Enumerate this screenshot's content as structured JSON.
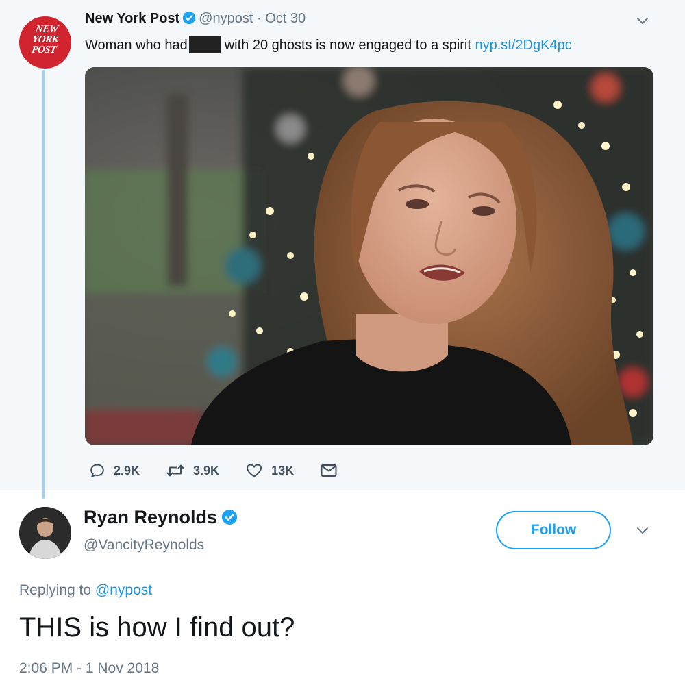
{
  "original_tweet": {
    "author_name": "New York Post",
    "author_handle": "@nypost",
    "separator": "·",
    "date": "Oct 30",
    "avatar_text": [
      "NEW",
      "YORK",
      "POST"
    ],
    "text_before": "Woman who had",
    "text_after": "with 20 ghosts is now engaged to a spirit",
    "link": "nyp.st/2DgK4pc",
    "stats": {
      "replies": "2.9K",
      "retweets": "3.9K",
      "likes": "13K"
    }
  },
  "reply_tweet": {
    "author_name": "Ryan Reynolds",
    "author_handle": "@VancityReynolds",
    "follow_label": "Follow",
    "replying_prefix": "Replying to",
    "replying_handle": "@nypost",
    "text": "THIS is how I find out?",
    "timestamp": "2:06 PM - 1 Nov 2018"
  },
  "icons": {
    "verified": "verified-badge-icon",
    "caret": "chevron-down-icon",
    "reply": "reply-icon",
    "retweet": "retweet-icon",
    "like": "heart-icon",
    "dm": "envelope-icon"
  },
  "colors": {
    "accent": "#1da1f2",
    "link": "#1b95e0",
    "muted": "#657786",
    "thread_line": "#a4d0ee",
    "nyp_red": "#d1242f",
    "top_background": "#f5f8fa"
  }
}
